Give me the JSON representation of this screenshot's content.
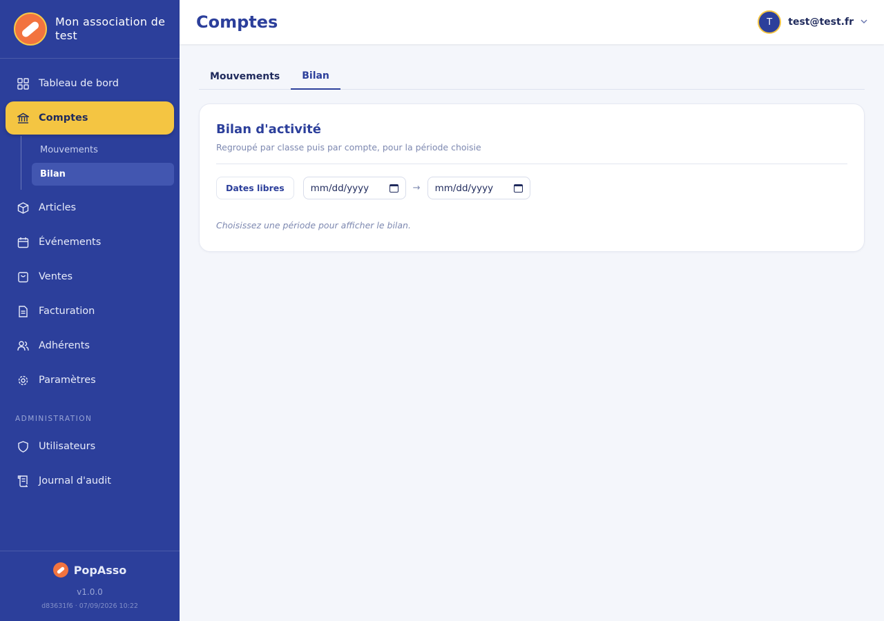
{
  "sidebar": {
    "org_name": "Mon association de test",
    "nav": [
      {
        "label": "Tableau de bord",
        "icon": "grid-icon"
      },
      {
        "label": "Comptes",
        "icon": "bank-icon"
      },
      {
        "label": "Articles",
        "icon": "box-icon"
      },
      {
        "label": "Événements",
        "icon": "calendar-icon"
      },
      {
        "label": "Ventes",
        "icon": "bag-icon"
      },
      {
        "label": "Facturation",
        "icon": "document-icon"
      },
      {
        "label": "Adhérents",
        "icon": "users-icon"
      },
      {
        "label": "Paramètres",
        "icon": "gear-icon"
      }
    ],
    "subnav": [
      {
        "label": "Mouvements"
      },
      {
        "label": "Bilan"
      }
    ],
    "admin_section": "ADMINISTRATION",
    "admin_nav": [
      {
        "label": "Utilisateurs",
        "icon": "shield-icon"
      },
      {
        "label": "Journal d'audit",
        "icon": "scroll-icon"
      }
    ],
    "footer": {
      "brand": "PopAsso",
      "version": "v1.0.0",
      "build": "d83631f6 · 07/09/2026 10:22"
    }
  },
  "header": {
    "title": "Comptes",
    "user_initial": "T",
    "user_email": "test@test.fr"
  },
  "tabs": [
    {
      "label": "Mouvements"
    },
    {
      "label": "Bilan"
    }
  ],
  "card": {
    "title": "Bilan d'activité",
    "subtitle": "Regroupé par classe puis par compte, pour la période choisie",
    "free_dates_button": "Dates libres",
    "date_from_placeholder": "mm/dd/yyyy",
    "date_to_placeholder": "mm/dd/yyyy",
    "arrow": "→",
    "hint": "Choisissez une période pour afficher le bilan."
  },
  "colors": {
    "sidebar": "#2c3f9b",
    "accent": "#f4c542",
    "brand_orange": "#f2733f"
  }
}
